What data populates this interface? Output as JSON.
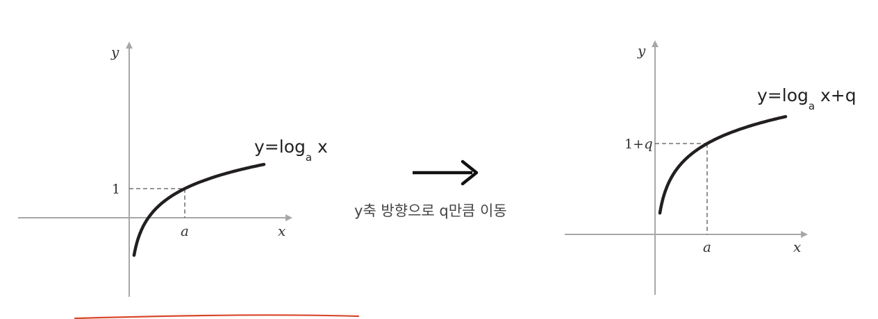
{
  "left_graph": {
    "y_axis_label": "y",
    "x_axis_label": "x",
    "y_tick": "1",
    "x_tick": "a",
    "equation_main": "y=log",
    "equation_sub": "a",
    "equation_tail": " x"
  },
  "right_graph": {
    "y_axis_label": "y",
    "x_axis_label": "x",
    "y_tick": "1+q",
    "x_tick": "a",
    "equation_main": "y=log",
    "equation_sub": "a",
    "equation_tail": " x+q"
  },
  "transition": {
    "caption": "y축 방향으로 q만큼 이동"
  },
  "colors": {
    "curve": "#231f20",
    "axis": "#a7a7a7",
    "underline": "#d9472b"
  }
}
